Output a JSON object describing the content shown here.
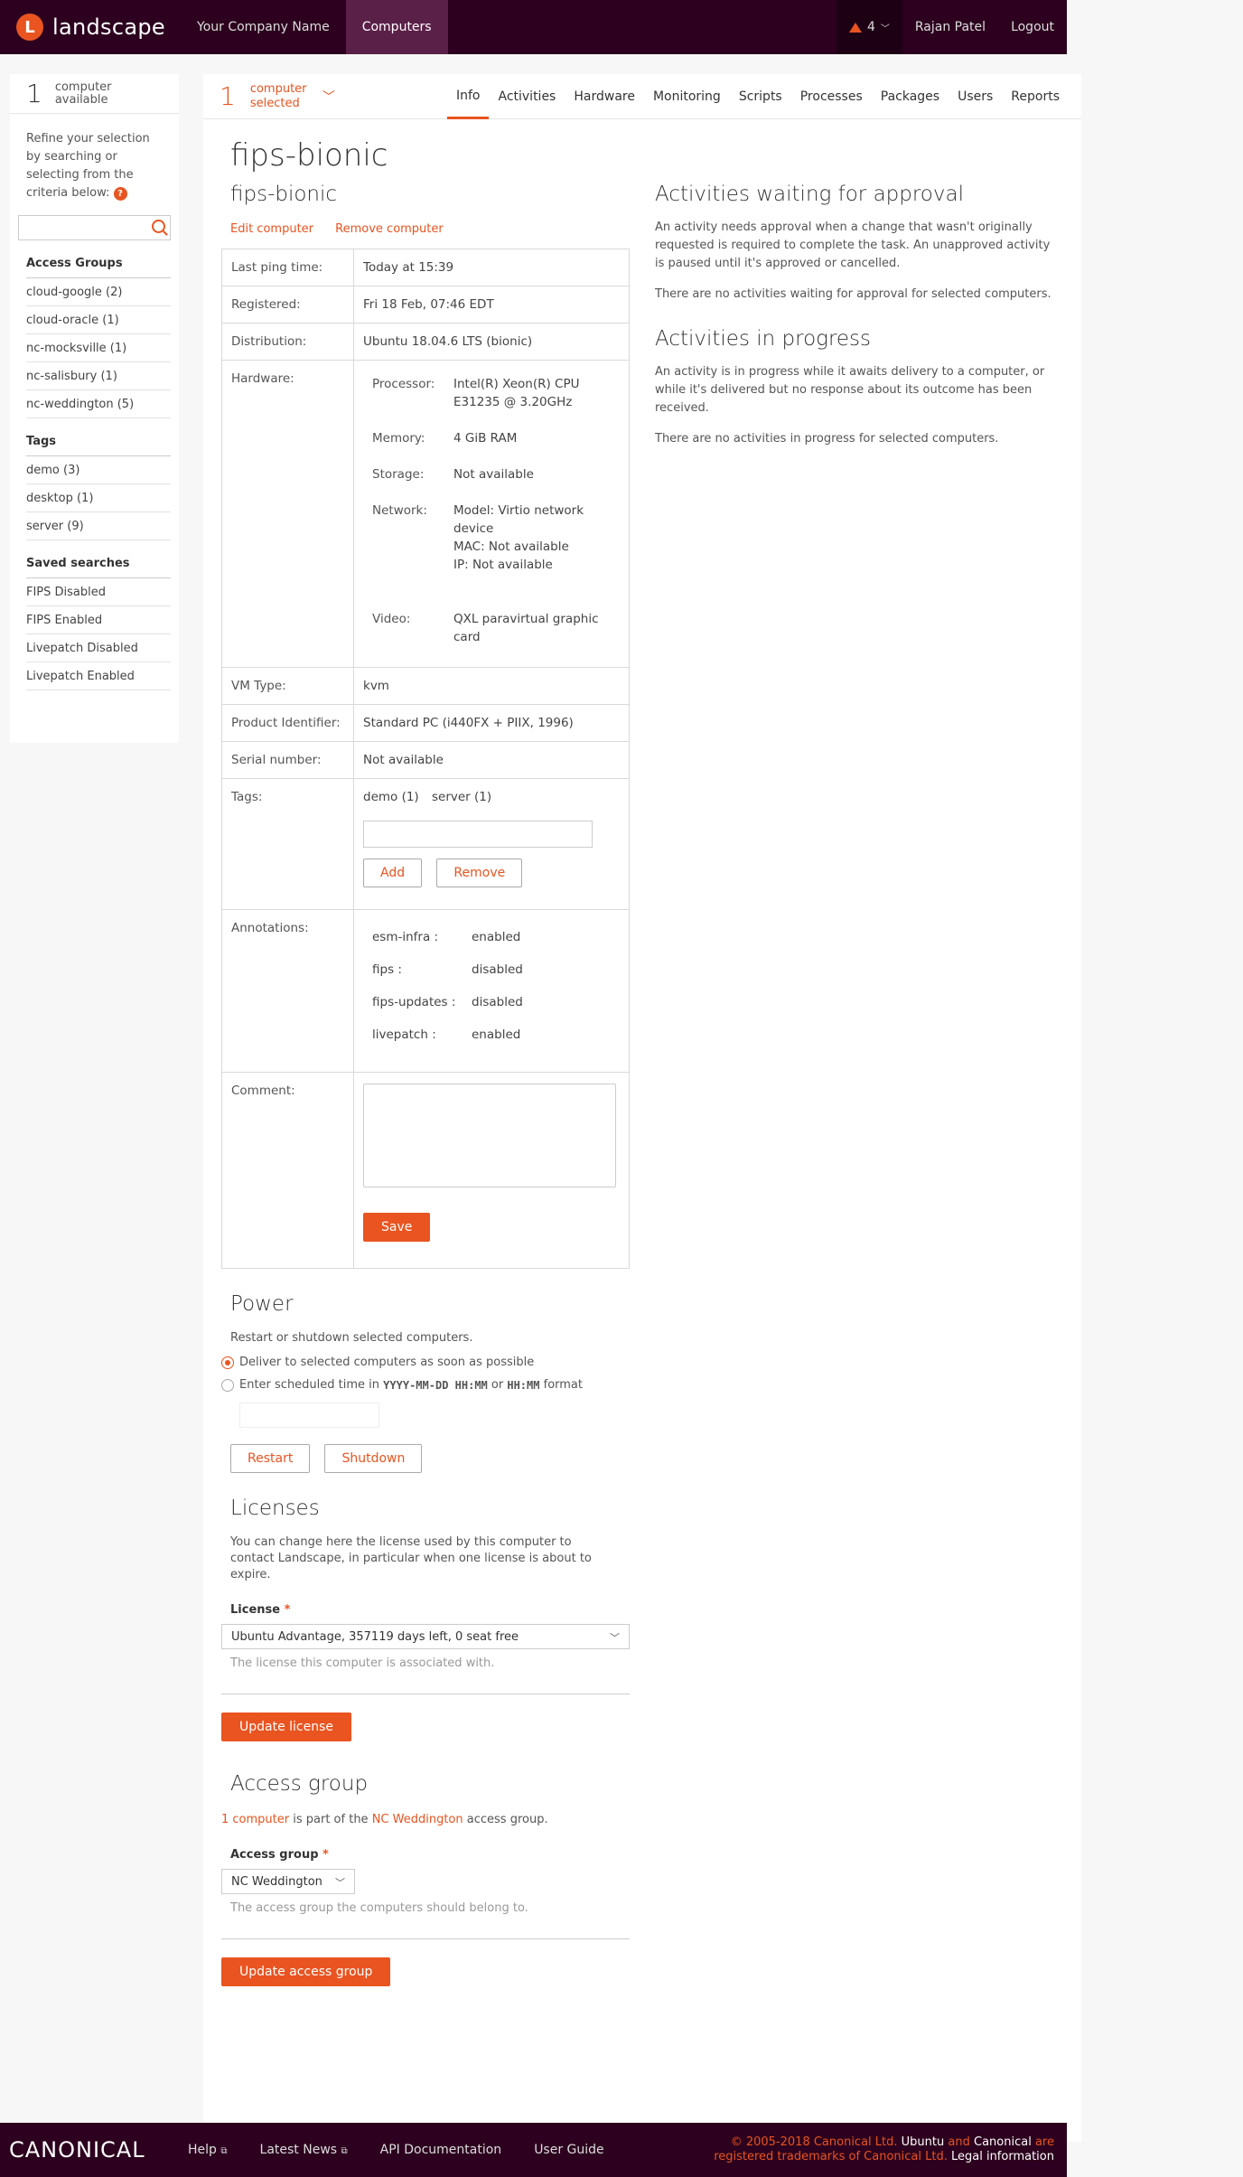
{
  "header": {
    "logo_text": "landscape",
    "logo_letter": "L",
    "nav": [
      "Your Company Name",
      "Computers"
    ],
    "alert_count": "4",
    "user": "Rajan Patel",
    "logout": "Logout"
  },
  "sidebar": {
    "count": "1",
    "count_label": "computer available",
    "refine_text": "Refine your selection by searching or selecting from the criteria below:",
    "help": "?",
    "access_groups_title": "Access Groups",
    "access_groups": [
      "cloud-google (2)",
      "cloud-oracle (1)",
      "nc-mocksville (1)",
      "nc-salisbury (1)",
      "nc-weddington (5)"
    ],
    "tags_title": "Tags",
    "tags": [
      "demo (3)",
      "desktop (1)",
      "server (9)"
    ],
    "saved_title": "Saved searches",
    "saved": [
      "FIPS Disabled",
      "FIPS Enabled",
      "Livepatch Disabled",
      "Livepatch Enabled"
    ]
  },
  "selection": {
    "count": "1",
    "label": "computer selected",
    "chevron": "﹀"
  },
  "tabs": [
    "Info",
    "Activities",
    "Hardware",
    "Monitoring",
    "Scripts",
    "Processes",
    "Packages",
    "Users",
    "Reports"
  ],
  "page_title": "fips-bionic",
  "computer": {
    "name": "fips-bionic",
    "edit": "Edit computer",
    "remove": "Remove computer",
    "last_ping_label": "Last ping time:",
    "last_ping": "Today at 15:39",
    "registered_label": "Registered:",
    "registered": "Fri 18 Feb, 07:46 EDT",
    "distribution_label": "Distribution:",
    "distribution": "Ubuntu 18.04.6 LTS (bionic)",
    "hardware_label": "Hardware:",
    "processor_label": "Processor:",
    "processor": "Intel(R) Xeon(R) CPU E31235 @ 3.20GHz",
    "memory_label": "Memory:",
    "memory": "4 GiB RAM",
    "storage_label": "Storage:",
    "storage": "Not available",
    "network_label": "Network:",
    "network_model": "Model: Virtio network device",
    "network_mac": "MAC: Not available",
    "network_ip": "IP: Not available",
    "video_label": "Video:",
    "video": "QXL paravirtual graphic card",
    "vm_label": "VM Type:",
    "vm": "kvm",
    "product_label": "Product Identifier:",
    "product": "Standard PC (i440FX + PIIX, 1996)",
    "serial_label": "Serial number:",
    "serial": "Not available",
    "tags_label": "Tags:",
    "tags": [
      "demo (1)",
      "server (1)"
    ],
    "add": "Add",
    "remove_tag": "Remove",
    "annotations_label": "Annotations:",
    "annotations": [
      {
        "k": "esm-infra :",
        "v": "enabled"
      },
      {
        "k": "fips :",
        "v": "disabled"
      },
      {
        "k": "fips-updates :",
        "v": "disabled"
      },
      {
        "k": "livepatch :",
        "v": "enabled"
      }
    ],
    "comment_label": "Comment:",
    "save": "Save"
  },
  "power": {
    "title": "Power",
    "desc": "Restart or shutdown selected computers.",
    "opt1": "Deliver to selected computers as soon as possible",
    "opt2_pre": "Enter scheduled time in",
    "opt2_fmt1": "YYYY-MM-DD HH:MM",
    "opt2_or": "or",
    "opt2_fmt2": "HH:MM",
    "opt2_post": "format",
    "restart": "Restart",
    "shutdown": "Shutdown"
  },
  "licenses": {
    "title": "Licenses",
    "desc": "You can change here the license used by this computer to contact Landscape, in particular when one license is about to expire.",
    "label": "License",
    "required": "*",
    "value": "Ubuntu Advantage, 357119 days left, 0 seat free",
    "hint": "The license this computer is associated with.",
    "button": "Update license"
  },
  "access_group": {
    "title": "Access group",
    "link1": "1 computer",
    "mid": "is part of the",
    "link2": "NC Weddington",
    "end": "access group.",
    "label": "Access group",
    "required": "*",
    "value": "NC Weddington",
    "hint": "The access group the computers should belong to.",
    "button": "Update access group"
  },
  "activities": {
    "waiting_title": "Activities waiting for approval",
    "waiting_desc": "An activity needs approval when a change that wasn't originally requested is required to complete the task. An unapproved activity is paused until it's approved or cancelled.",
    "waiting_none": "There are no activities waiting for approval for selected computers.",
    "progress_title": "Activities in progress",
    "progress_desc": "An activity is in progress while it awaits delivery to a computer, or while it's delivered but no response about its outcome has been received.",
    "progress_none": "There are no activities in progress for selected computers."
  },
  "footer": {
    "brand": "CANONICAL",
    "links": [
      "Help",
      "Latest News",
      "API Documentation",
      "User Guide"
    ],
    "copyright": "© 2005-2018 Canonical Ltd.",
    "ubuntu": "Ubuntu",
    "and": "and",
    "canonical": "Canonical",
    "are": "are",
    "trademarks": "registered trademarks of Canonical Ltd.",
    "legal": "Legal information",
    "ext_icon": "⧉"
  }
}
